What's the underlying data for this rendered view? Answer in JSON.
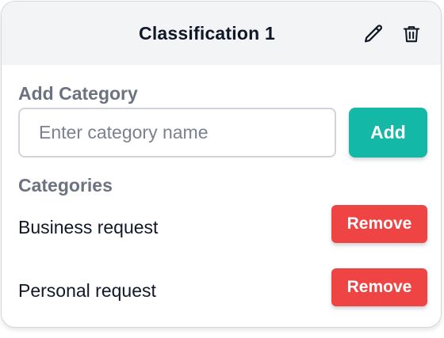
{
  "header": {
    "title": "Classification 1",
    "edit_icon": "pencil-icon",
    "delete_icon": "trash-icon"
  },
  "add_category": {
    "label": "Add Category",
    "input_value": "",
    "input_placeholder": "Enter category name",
    "add_button_label": "Add"
  },
  "categories": {
    "label": "Categories",
    "items": [
      {
        "name": "Business request",
        "remove_label": "Remove"
      },
      {
        "name": "Personal request",
        "remove_label": "Remove"
      }
    ]
  },
  "colors": {
    "header_bg": "#f3f4f6",
    "add_button": "#14b8a6",
    "remove_button": "#ef4444",
    "muted_label": "#6b7280"
  }
}
